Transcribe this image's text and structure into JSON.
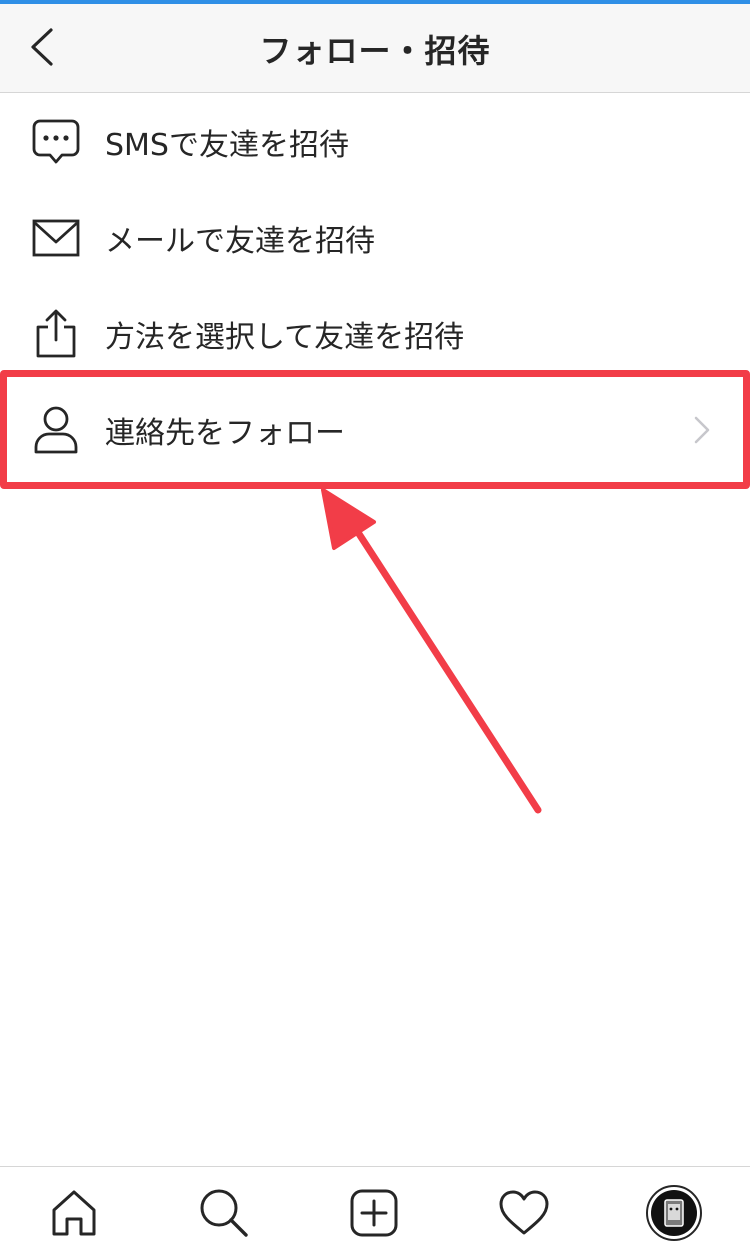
{
  "header": {
    "title": "フォロー・招待",
    "back_icon": "chevron-left-icon"
  },
  "menu": {
    "items": [
      {
        "label": "SMSで友達を招待",
        "icon": "message-bubble-icon"
      },
      {
        "label": "メールで友達を招待",
        "icon": "mail-icon"
      },
      {
        "label": "方法を選択して友達を招待",
        "icon": "share-icon"
      },
      {
        "label": "連絡先をフォロー",
        "icon": "person-icon",
        "has_chevron": true
      }
    ]
  },
  "annotation": {
    "highlight_color": "#f23d48",
    "highlighted_item": "連絡先をフォロー"
  },
  "tabbar": {
    "tabs": [
      "home-icon",
      "search-icon",
      "new-post-icon",
      "activity-heart-icon",
      "profile-avatar"
    ]
  },
  "colors": {
    "accent_top": "#2f8fe6",
    "text": "#262626",
    "chevron": "#c7c7cc"
  }
}
